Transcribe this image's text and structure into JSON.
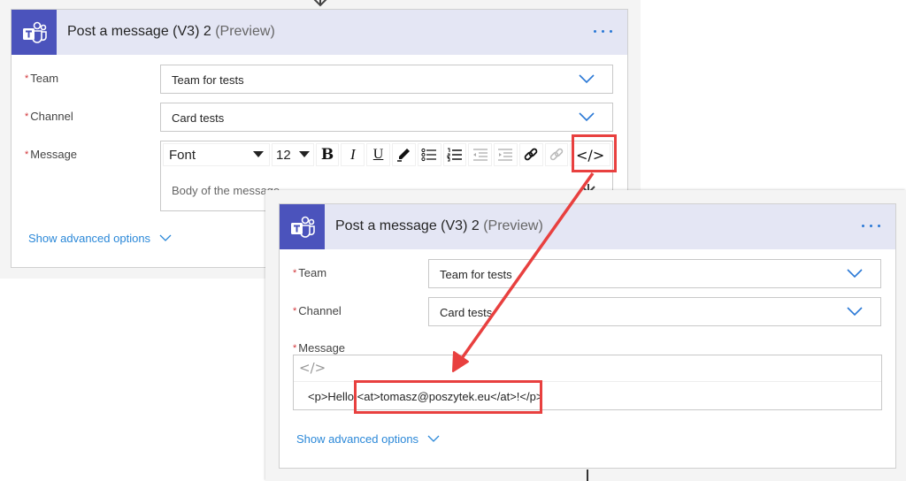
{
  "colors": {
    "teams_brand": "#4b53bc",
    "header_bg": "#e4e6f4",
    "link": "#2b88d8",
    "required": "#d13438",
    "highlight": "#e8403f"
  },
  "before": {
    "card": {
      "title": "Post a message (V3) 2",
      "title_suffix": "(Preview)",
      "more_icon": "ellipsis-icon"
    },
    "fields": {
      "team": {
        "required_mark": "*",
        "label": "Team",
        "value": "Team for tests"
      },
      "channel": {
        "required_mark": "*",
        "label": "Channel",
        "value": "Card tests"
      },
      "message": {
        "required_mark": "*",
        "label": "Message",
        "placeholder": "Body of the message"
      }
    },
    "toolbar": {
      "font": "Font",
      "size": "12",
      "buttons": [
        "bold",
        "italic",
        "underline",
        "highlight-color",
        "bulleted-list",
        "numbered-list",
        "decrease-indent",
        "increase-indent",
        "link",
        "unlink",
        "code-view"
      ],
      "code_glyph": "</>"
    },
    "advanced_label": "Show advanced options"
  },
  "after": {
    "card": {
      "title": "Post a message (V3) 2",
      "title_suffix": "(Preview)",
      "more_icon": "ellipsis-icon"
    },
    "fields": {
      "team": {
        "required_mark": "*",
        "label": "Team",
        "value": "Team for tests"
      },
      "channel": {
        "required_mark": "*",
        "label": "Channel",
        "value": "Card tests"
      },
      "message": {
        "required_mark": "*",
        "label": "Message",
        "code_glyph": "</>",
        "value": "<p>Hello <at>tomasz@poszytek.eu</at>!</p>"
      }
    },
    "advanced_label": "Show advanced options"
  }
}
